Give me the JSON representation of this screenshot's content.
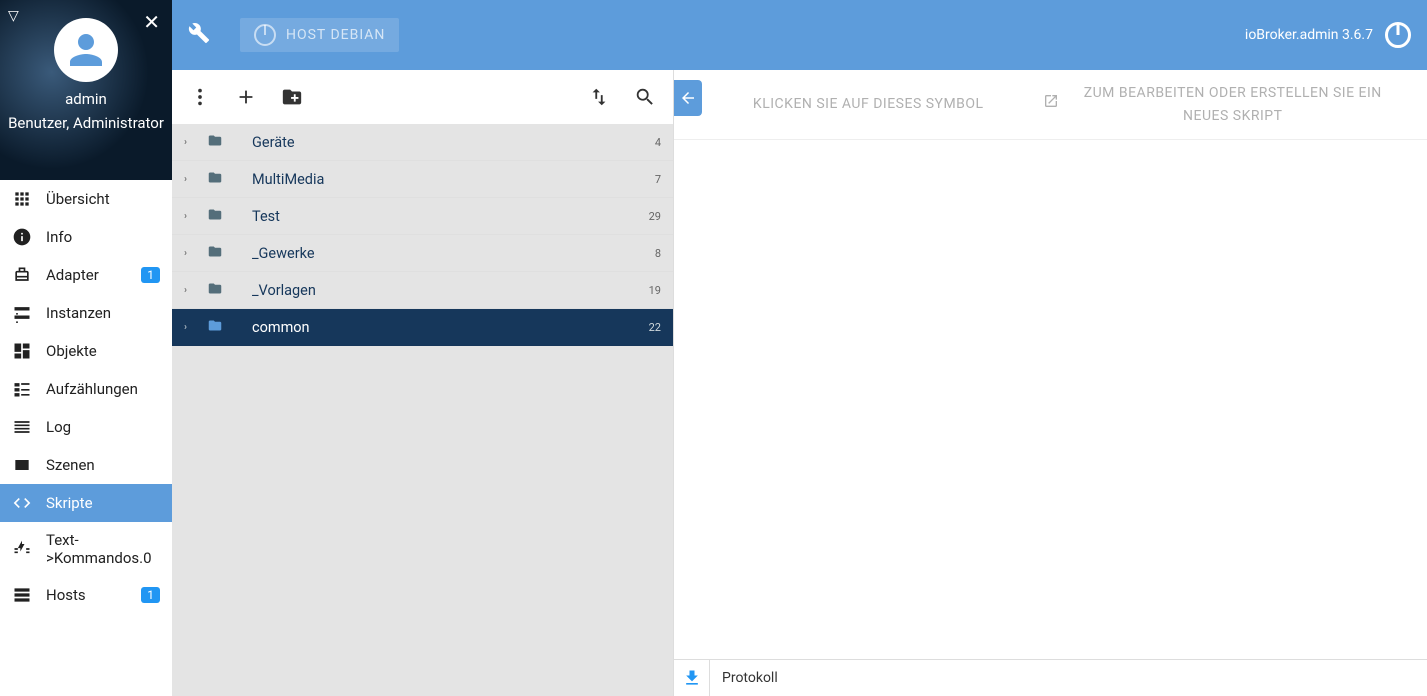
{
  "user": {
    "name": "admin",
    "role": "Benutzer, Administrator"
  },
  "nav": [
    {
      "icon": "apps",
      "label": "Übersicht",
      "badge": null
    },
    {
      "icon": "info",
      "label": "Info",
      "badge": null
    },
    {
      "icon": "adapter",
      "label": "Adapter",
      "badge": "1"
    },
    {
      "icon": "instances",
      "label": "Instanzen",
      "badge": null
    },
    {
      "icon": "objects",
      "label": "Objekte",
      "badge": null
    },
    {
      "icon": "enum",
      "label": "Aufzählungen",
      "badge": null
    },
    {
      "icon": "log",
      "label": "Log",
      "badge": null
    },
    {
      "icon": "scenes",
      "label": "Szenen",
      "badge": null
    },
    {
      "icon": "code",
      "label": "Skripte",
      "badge": null,
      "active": true
    },
    {
      "icon": "text",
      "label": "Text->Kommandos.0",
      "badge": null
    },
    {
      "icon": "hosts",
      "label": "Hosts",
      "badge": "1"
    }
  ],
  "topbar": {
    "host": "HOST DEBIAN",
    "version": "ioBroker.admin 3.6.7"
  },
  "tree": [
    {
      "name": "Geräte",
      "count": "4"
    },
    {
      "name": "MultiMedia",
      "count": "7"
    },
    {
      "name": "Test",
      "count": "29"
    },
    {
      "name": "_Gewerke",
      "count": "8"
    },
    {
      "name": "_Vorlagen",
      "count": "19"
    },
    {
      "name": "common",
      "count": "22",
      "selected": true
    }
  ],
  "editor": {
    "hint1": "KLICKEN SIE AUF DIESES SYMBOL",
    "hint2": "ZUM BEARBEITEN ODER ERSTELLEN SIE EIN NEUES SKRIPT",
    "protokoll": "Protokoll"
  }
}
